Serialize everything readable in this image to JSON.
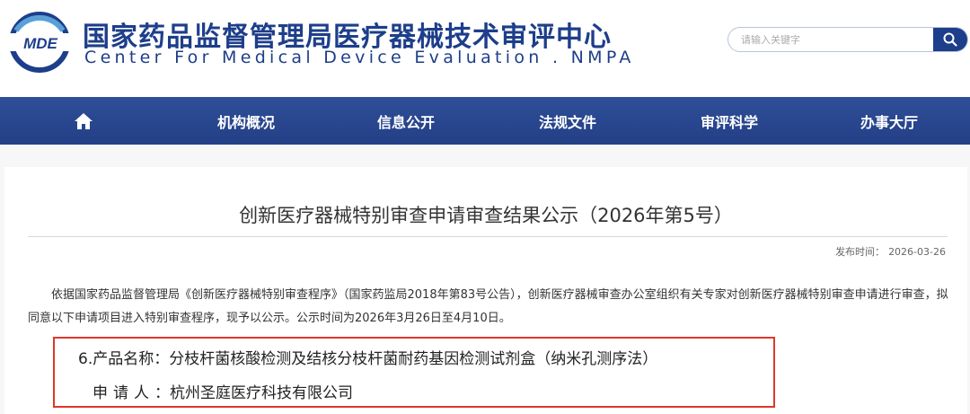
{
  "header": {
    "logo_text": "MDE",
    "title_cn": "国家药品监督管理局医疗器械技术审评中心",
    "title_en": "Center For Medical Device Evaluation . NMPA",
    "search_placeholder": "请输入关键字"
  },
  "nav": {
    "items": [
      {
        "label": "机构概况"
      },
      {
        "label": "信息公开"
      },
      {
        "label": "法规文件"
      },
      {
        "label": "审评科学"
      },
      {
        "label": "办事大厅"
      }
    ]
  },
  "article": {
    "title": "创新医疗器械特别审查申请审查结果公示（2026年第5号）",
    "publish_label": "发布时间：",
    "publish_date": "2026-03-26",
    "body": "依据国家药品监督管理局《创新医疗器械特别审查程序》（国家药监局2018年第83号公告），创新医疗器械审查办公室组织有关专家对创新医疗器械特别审查申请进行审查，拟同意以下申请项目进入特别审查程序，现予以公示。公示时间为2026年3月26日至4月10日。",
    "item_number": "6.",
    "product_label": "产品名称：",
    "product_name": "分枝杆菌核酸检测及结核分枝杆菌耐药基因检测试剂盒（纳米孔测序法）",
    "applicant_label": "申请人",
    "applicant_colon": "：",
    "applicant_name": "杭州圣庭医疗科技有限公司"
  },
  "colors": {
    "brand": "#1d3e8a",
    "nav_bg": "#2a4890",
    "highlight_border": "#e0362c"
  }
}
